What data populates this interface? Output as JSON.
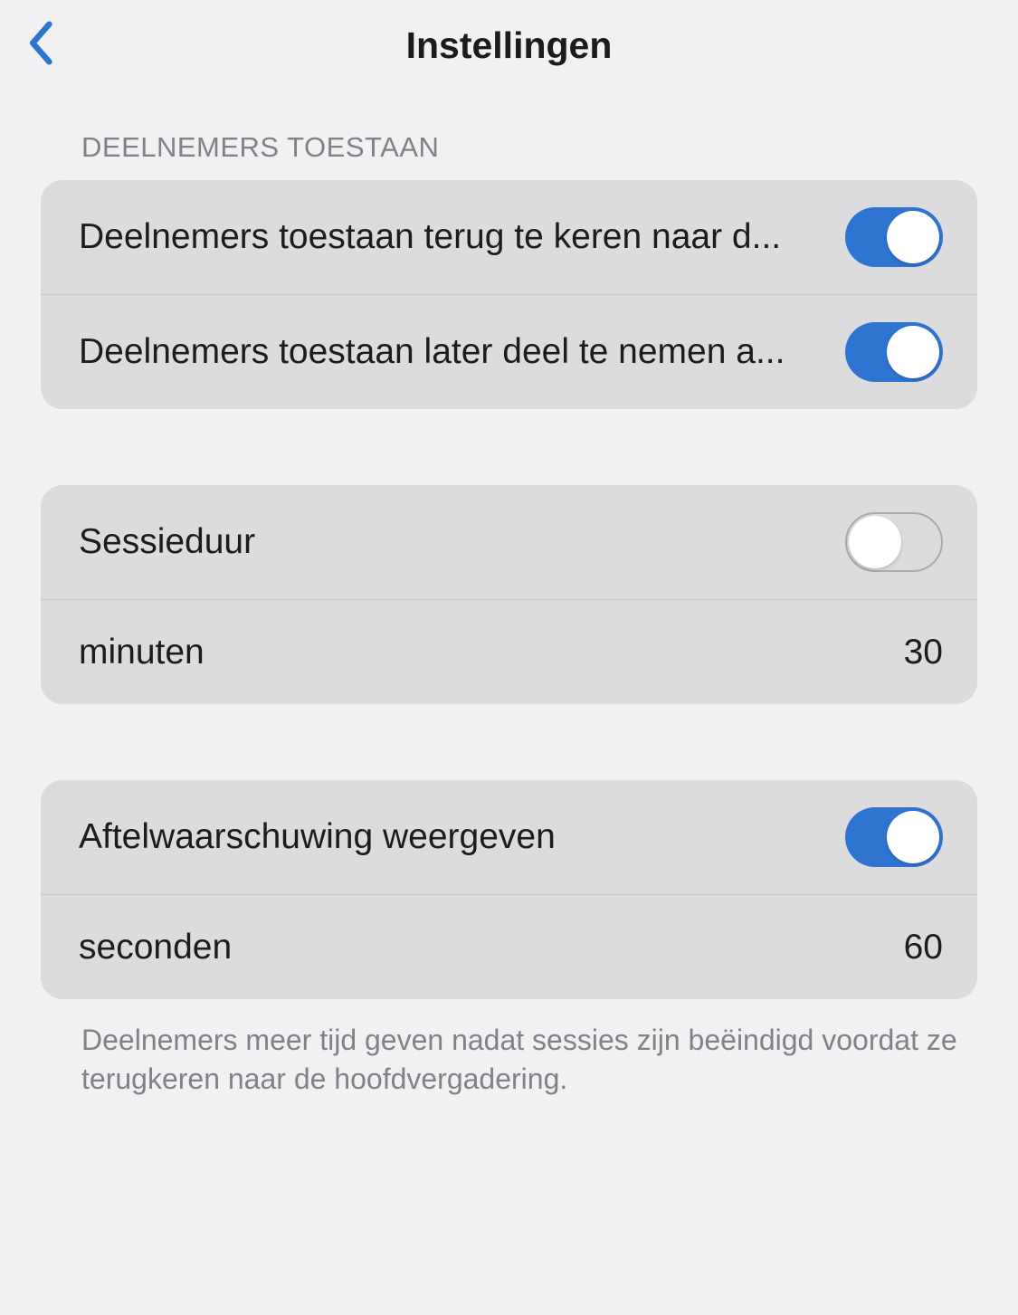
{
  "header": {
    "title": "Instellingen"
  },
  "sections": {
    "participants": {
      "header": "DEELNEMERS TOESTAAN",
      "allow_return_label": "Deelnemers toestaan terug te keren naar d...",
      "allow_return_enabled": true,
      "allow_later_label": "Deelnemers toestaan later deel te nemen a...",
      "allow_later_enabled": true
    },
    "session_duration": {
      "label": "Sessieduur",
      "enabled": false,
      "unit_label": "minuten",
      "unit_value": "30"
    },
    "countdown": {
      "label": "Aftelwaarschuwing weergeven",
      "enabled": true,
      "unit_label": "seconden",
      "unit_value": "60"
    },
    "footer_note": "Deelnemers meer tijd geven nadat sessies zijn beëindigd voordat ze terugkeren naar de hoofdvergadering."
  }
}
